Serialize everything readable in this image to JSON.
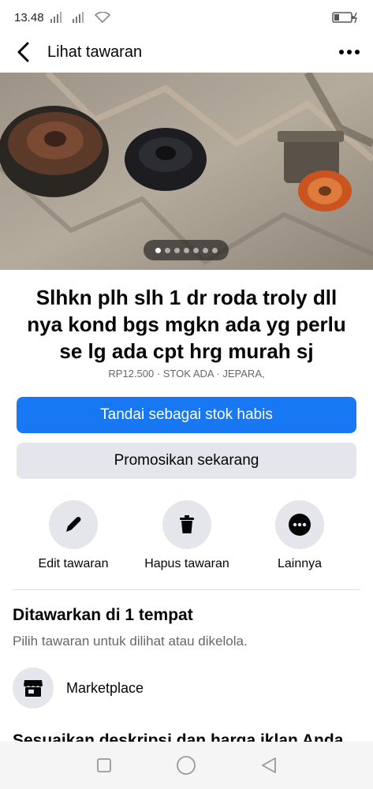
{
  "status_bar": {
    "time": "13.48"
  },
  "header": {
    "title": "Lihat tawaran"
  },
  "carousel": {
    "total": 7,
    "active_index": 0
  },
  "listing": {
    "title": "Slhkn plh slh 1 dr roda troly dll nya kond bgs mgkn ada yg perlu se lg ada cpt hrg murah sj",
    "meta": "RP12.500 · STOK ADA · JEPARA,"
  },
  "buttons": {
    "mark_sold": "Tandai sebagai stok habis",
    "promote": "Promosikan sekarang"
  },
  "actions": {
    "edit": "Edit tawaran",
    "delete": "Hapus tawaran",
    "more": "Lainnya"
  },
  "offered": {
    "title": "Ditawarkan di 1 tempat",
    "subtitle": "Pilih tawaran untuk dilihat atau dikelola.",
    "place": "Marketplace"
  },
  "cut_off_heading": "Sesuaikan deskripsi dan harga iklan Anda",
  "colors": {
    "primary": "#1877f2",
    "secondary_bg": "#e4e6eb",
    "muted_text": "#65676b"
  },
  "icons": [
    "back-arrow-icon",
    "more-dots-icon",
    "pencil-icon",
    "trash-icon",
    "ellipsis-icon",
    "store-icon",
    "square-icon",
    "circle-icon",
    "triangle-back-icon"
  ]
}
